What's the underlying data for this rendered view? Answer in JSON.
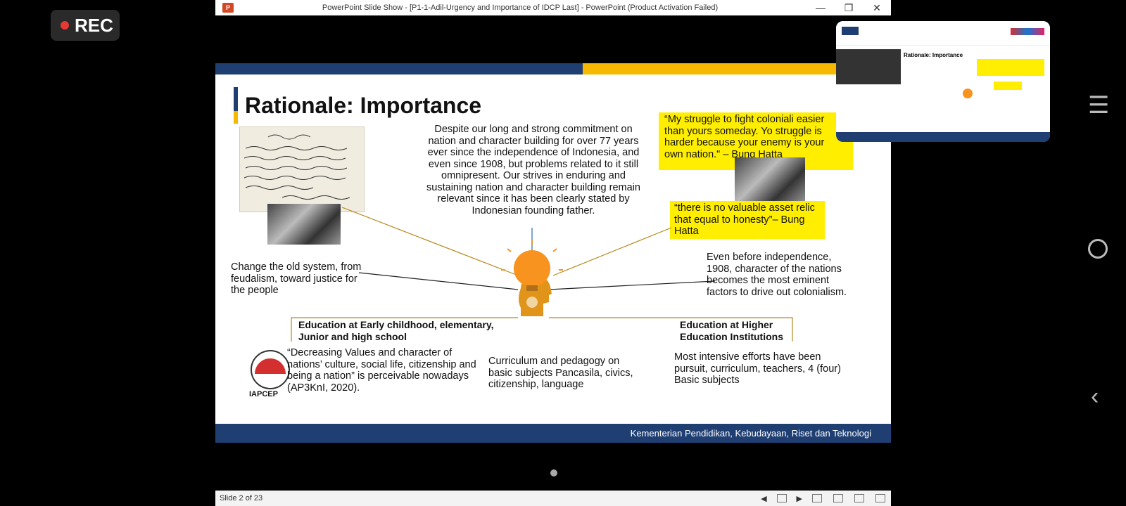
{
  "rec_label": "REC",
  "window": {
    "title": "PowerPoint Slide Show - [P1-1-Adil-Urgency and Importance of IDCP Last] - PowerPoint (Product Activation Failed)",
    "app_icon_label": "P"
  },
  "slide": {
    "title": "Rationale: Importance",
    "center_paragraph": "Despite our long and strong commitment on nation and character building for over 77 years ever since the independence of Indonesia, and even since 1908, but problems related to it still omnipresent. Our strives in enduring and sustaining nation and character building remain relevant since it has been clearly stated by Indonesian founding father.",
    "quote1": "“My struggle to fight coloniali easier than yours someday. Yo struggle is harder because your enemy is your own nation.\" – Bung Hatta",
    "quote2": "“there is no valuable asset relic that equal to honesty”– Bung Hatta",
    "left_text": "Change the old system, from feudalism, toward justice for the people",
    "right_text": "Even before independence, 1908, character of the nations becomes the most eminent factors to drive out colonialism.",
    "edu_early_heading": "Education at Early childhood, elementary, Junior and high school",
    "edu_higher_heading": "Education at Higher Education Institutions",
    "decreasing_quote": "“Decreasing Values and character of nations’ culture, social life, citizenship and being a nation” is perceivable nowadays (AP3KnI, 2020).",
    "curriculum_text": "Curriculum and pedagogy on basic subjects Pancasila, civics, citizenship, language",
    "higher_text": "Most intensive efforts have been pursuit, curriculum, teachers, 4 (four) Basic subjects",
    "iapcep_label": "IAPCEP",
    "footer": "Kementerian Pendidikan, Kebudayaan, Riset dan Teknologi"
  },
  "thumbnail": {
    "title": "Rationale: Importance"
  },
  "statusbar": {
    "slide_counter": "Slide 2 of 23"
  },
  "colors": {
    "navy": "#1f3f73",
    "yellow": "#f7b900",
    "highlight": "#ffee00",
    "bulb": "#f7931e"
  },
  "icons": [
    "menu-icon",
    "home-circle-icon",
    "back-chevron-icon",
    "record-dot-icon",
    "lightbulb-head-icon"
  ]
}
